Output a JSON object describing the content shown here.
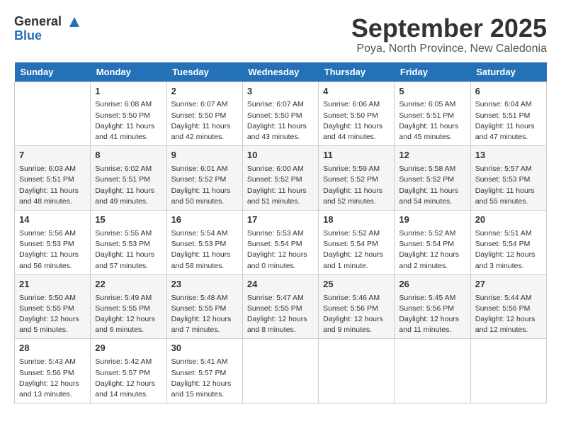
{
  "header": {
    "logo_line1": "General",
    "logo_line2": "Blue",
    "month": "September 2025",
    "location": "Poya, North Province, New Caledonia"
  },
  "days_of_week": [
    "Sunday",
    "Monday",
    "Tuesday",
    "Wednesday",
    "Thursday",
    "Friday",
    "Saturday"
  ],
  "weeks": [
    [
      {
        "day": "",
        "sunrise": "",
        "sunset": "",
        "daylight": ""
      },
      {
        "day": "1",
        "sunrise": "6:08 AM",
        "sunset": "5:50 PM",
        "daylight": "11 hours and 41 minutes."
      },
      {
        "day": "2",
        "sunrise": "6:07 AM",
        "sunset": "5:50 PM",
        "daylight": "11 hours and 42 minutes."
      },
      {
        "day": "3",
        "sunrise": "6:07 AM",
        "sunset": "5:50 PM",
        "daylight": "11 hours and 43 minutes."
      },
      {
        "day": "4",
        "sunrise": "6:06 AM",
        "sunset": "5:50 PM",
        "daylight": "11 hours and 44 minutes."
      },
      {
        "day": "5",
        "sunrise": "6:05 AM",
        "sunset": "5:51 PM",
        "daylight": "11 hours and 45 minutes."
      },
      {
        "day": "6",
        "sunrise": "6:04 AM",
        "sunset": "5:51 PM",
        "daylight": "11 hours and 47 minutes."
      }
    ],
    [
      {
        "day": "7",
        "sunrise": "6:03 AM",
        "sunset": "5:51 PM",
        "daylight": "11 hours and 48 minutes."
      },
      {
        "day": "8",
        "sunrise": "6:02 AM",
        "sunset": "5:51 PM",
        "daylight": "11 hours and 49 minutes."
      },
      {
        "day": "9",
        "sunrise": "6:01 AM",
        "sunset": "5:52 PM",
        "daylight": "11 hours and 50 minutes."
      },
      {
        "day": "10",
        "sunrise": "6:00 AM",
        "sunset": "5:52 PM",
        "daylight": "11 hours and 51 minutes."
      },
      {
        "day": "11",
        "sunrise": "5:59 AM",
        "sunset": "5:52 PM",
        "daylight": "11 hours and 52 minutes."
      },
      {
        "day": "12",
        "sunrise": "5:58 AM",
        "sunset": "5:52 PM",
        "daylight": "11 hours and 54 minutes."
      },
      {
        "day": "13",
        "sunrise": "5:57 AM",
        "sunset": "5:53 PM",
        "daylight": "11 hours and 55 minutes."
      }
    ],
    [
      {
        "day": "14",
        "sunrise": "5:56 AM",
        "sunset": "5:53 PM",
        "daylight": "11 hours and 56 minutes."
      },
      {
        "day": "15",
        "sunrise": "5:55 AM",
        "sunset": "5:53 PM",
        "daylight": "11 hours and 57 minutes."
      },
      {
        "day": "16",
        "sunrise": "5:54 AM",
        "sunset": "5:53 PM",
        "daylight": "11 hours and 58 minutes."
      },
      {
        "day": "17",
        "sunrise": "5:53 AM",
        "sunset": "5:54 PM",
        "daylight": "12 hours and 0 minutes."
      },
      {
        "day": "18",
        "sunrise": "5:52 AM",
        "sunset": "5:54 PM",
        "daylight": "12 hours and 1 minute."
      },
      {
        "day": "19",
        "sunrise": "5:52 AM",
        "sunset": "5:54 PM",
        "daylight": "12 hours and 2 minutes."
      },
      {
        "day": "20",
        "sunrise": "5:51 AM",
        "sunset": "5:54 PM",
        "daylight": "12 hours and 3 minutes."
      }
    ],
    [
      {
        "day": "21",
        "sunrise": "5:50 AM",
        "sunset": "5:55 PM",
        "daylight": "12 hours and 5 minutes."
      },
      {
        "day": "22",
        "sunrise": "5:49 AM",
        "sunset": "5:55 PM",
        "daylight": "12 hours and 6 minutes."
      },
      {
        "day": "23",
        "sunrise": "5:48 AM",
        "sunset": "5:55 PM",
        "daylight": "12 hours and 7 minutes."
      },
      {
        "day": "24",
        "sunrise": "5:47 AM",
        "sunset": "5:55 PM",
        "daylight": "12 hours and 8 minutes."
      },
      {
        "day": "25",
        "sunrise": "5:46 AM",
        "sunset": "5:56 PM",
        "daylight": "12 hours and 9 minutes."
      },
      {
        "day": "26",
        "sunrise": "5:45 AM",
        "sunset": "5:56 PM",
        "daylight": "12 hours and 11 minutes."
      },
      {
        "day": "27",
        "sunrise": "5:44 AM",
        "sunset": "5:56 PM",
        "daylight": "12 hours and 12 minutes."
      }
    ],
    [
      {
        "day": "28",
        "sunrise": "5:43 AM",
        "sunset": "5:56 PM",
        "daylight": "12 hours and 13 minutes."
      },
      {
        "day": "29",
        "sunrise": "5:42 AM",
        "sunset": "5:57 PM",
        "daylight": "12 hours and 14 minutes."
      },
      {
        "day": "30",
        "sunrise": "5:41 AM",
        "sunset": "5:57 PM",
        "daylight": "12 hours and 15 minutes."
      },
      {
        "day": "",
        "sunrise": "",
        "sunset": "",
        "daylight": ""
      },
      {
        "day": "",
        "sunrise": "",
        "sunset": "",
        "daylight": ""
      },
      {
        "day": "",
        "sunrise": "",
        "sunset": "",
        "daylight": ""
      },
      {
        "day": "",
        "sunrise": "",
        "sunset": "",
        "daylight": ""
      }
    ]
  ]
}
